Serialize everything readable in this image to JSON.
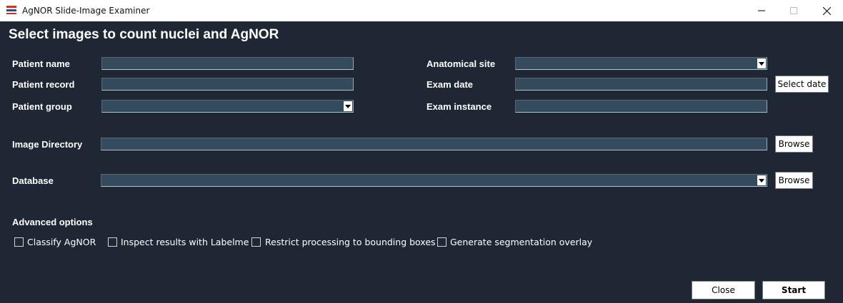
{
  "window": {
    "title": "AgNOR Slide-Image Examiner",
    "icon": "ufrgs-logo-icon"
  },
  "heading": "Select images to count nuclei and AgNOR",
  "form": {
    "patient_name": {
      "label": "Patient name",
      "value": ""
    },
    "patient_record": {
      "label": "Patient record",
      "value": ""
    },
    "patient_group": {
      "label": "Patient group",
      "value": ""
    },
    "anatomical_site": {
      "label": "Anatomical site",
      "value": ""
    },
    "exam_date": {
      "label": "Exam date",
      "value": ""
    },
    "exam_instance": {
      "label": "Exam instance",
      "value": ""
    },
    "image_directory": {
      "label": "Image Directory",
      "value": ""
    },
    "database": {
      "label": "Database",
      "value": ""
    }
  },
  "buttons": {
    "select_date": "Select date",
    "browse": "Browse",
    "close": "Close",
    "start": "Start"
  },
  "advanced": {
    "title": "Advanced options",
    "options": [
      {
        "label": "Classify AgNOR",
        "checked": false
      },
      {
        "label": "Inspect results with Labelme",
        "checked": false
      },
      {
        "label": "Restrict processing to bounding boxes",
        "checked": false
      },
      {
        "label": "Generate segmentation overlay",
        "checked": false
      }
    ]
  },
  "colors": {
    "background": "#1e2733",
    "field": "#344b5e",
    "text": "#ffffff"
  }
}
